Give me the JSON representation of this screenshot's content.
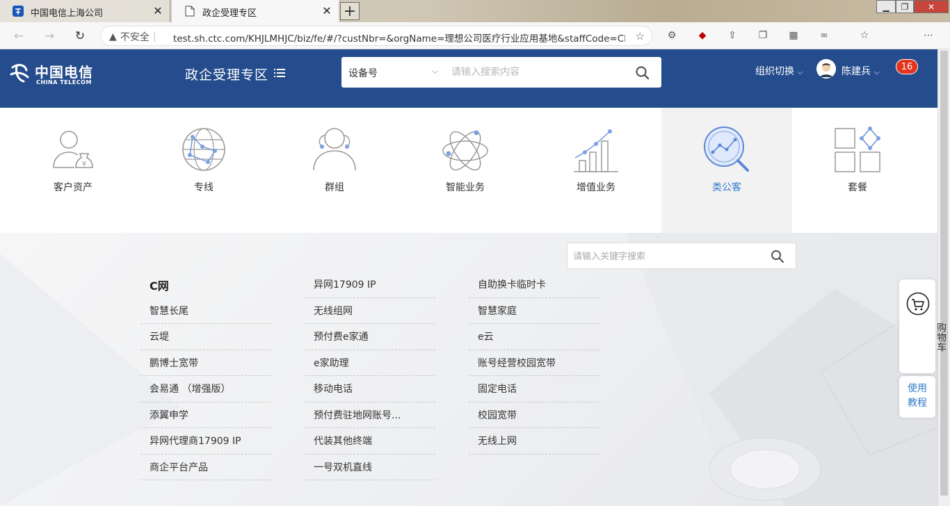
{
  "browser": {
    "tabs": [
      {
        "label": "中国电信上海公司",
        "icon": "china-telecom-favicon"
      },
      {
        "label": "政企受理专区",
        "icon": "page-icon"
      }
    ],
    "new_tab": "+",
    "security_label": "不安全",
    "url": "test.sh.ctc.com/KHJLMHJC/biz/fe/#/?custNbr=&orgName=理想公司医疗行业应用基地&staffCode=CH..."
  },
  "header": {
    "logo_text_cn": "中国电信",
    "logo_text_en": "CHINA TELECOM",
    "portal_title": "政企受理专区",
    "search_type": "设备号",
    "search_placeholder": "请输入搜索内容",
    "org_switch": "组织切换",
    "user_name": "陈建兵",
    "notification_count": "16"
  },
  "categories": [
    {
      "label": "客户资产",
      "icon": "customer-asset-icon"
    },
    {
      "label": "专线",
      "icon": "dedicated-line-icon"
    },
    {
      "label": "群组",
      "icon": "group-icon"
    },
    {
      "label": "智能业务",
      "icon": "smart-service-icon"
    },
    {
      "label": "增值业务",
      "icon": "value-added-icon"
    },
    {
      "label": "类公客",
      "icon": "search-analysis-icon",
      "active": true
    },
    {
      "label": "套餐",
      "icon": "package-icon"
    }
  ],
  "keyword_search": {
    "placeholder": "请输入关键字搜索"
  },
  "products": {
    "col1": [
      "C网",
      "智慧长尾",
      "云堤",
      "鹏博士宽带",
      "会易通 （增强版）",
      "添翼申学",
      "异网代理商17909 IP",
      "商企平台产品"
    ],
    "col2": [
      "异网17909 IP",
      "无线组网",
      "预付费e家通",
      "e家助理",
      "移动电话",
      "预付费驻地网账号...",
      "代装其他终端",
      "一号双机直线"
    ],
    "col3": [
      "自助换卡临时卡",
      "智慧家庭",
      "e云",
      "账号经营校园宽带",
      "固定电话",
      "校园宽带",
      "无线上网"
    ]
  },
  "side": {
    "cart": "购物车",
    "tutorial": "使用教程"
  },
  "colors": {
    "header_bg": "#254c8c",
    "active_text": "#2f79c9",
    "badge": "#e5341e"
  }
}
